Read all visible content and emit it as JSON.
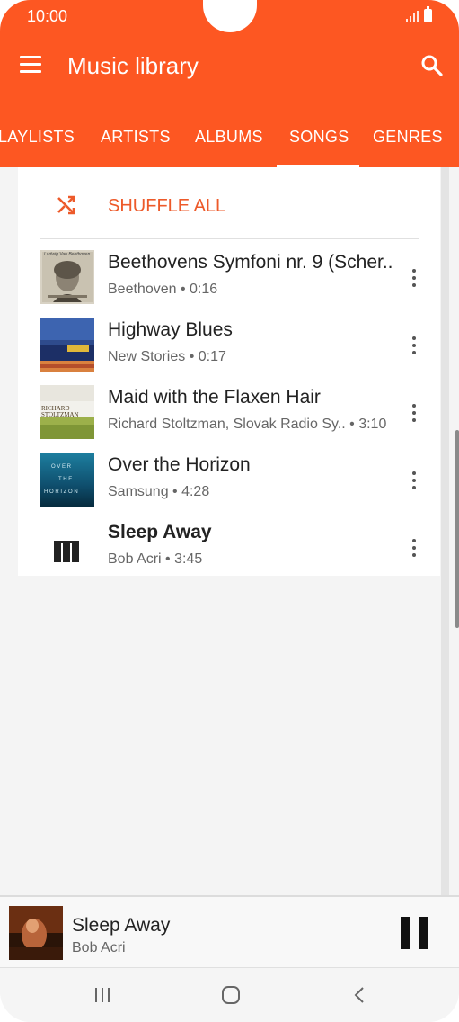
{
  "status_bar": {
    "time": "10:00",
    "icons": [
      "signal-icon",
      "battery-icon"
    ]
  },
  "header": {
    "title": "Music library",
    "menu_icon": "menu-icon",
    "search_icon": "search-icon"
  },
  "tabs": [
    {
      "label": "LAYLISTS",
      "selected": false
    },
    {
      "label": "ARTISTS",
      "selected": false
    },
    {
      "label": "ALBUMS",
      "selected": false
    },
    {
      "label": "SONGS",
      "selected": true
    },
    {
      "label": "GENRES",
      "selected": false
    }
  ],
  "shuffle": {
    "label": "SHUFFLE ALL",
    "icon": "shuffle-icon"
  },
  "songs": [
    {
      "title": "Beethovens Symfoni nr. 9 (Scher..",
      "subtitle": "Beethoven • 0:16",
      "playing": false
    },
    {
      "title": "Highway Blues",
      "subtitle": "New Stories • 0:17",
      "playing": false
    },
    {
      "title": "Maid with the Flaxen Hair",
      "subtitle": "Richard Stoltzman, Slovak Radio Sy..  • 3:10",
      "playing": false
    },
    {
      "title": "Over the Horizon",
      "subtitle": "Samsung • 4:28",
      "playing": false
    },
    {
      "title": "Sleep Away",
      "subtitle": "Bob Acri • 3:45",
      "playing": true
    }
  ],
  "album_art_text": {
    "beethoven": "Ludwig Van Beethoven",
    "stoltzman": [
      "RICHARD",
      "STOLTZMAN"
    ],
    "horizon": [
      "O V E R",
      "T H E",
      "H O R I Z O N"
    ]
  },
  "now_playing": {
    "title": "Sleep Away",
    "artist": "Bob Acri",
    "state_icon": "pause-icon"
  },
  "navigation": [
    "recent-apps-icon",
    "home-icon",
    "back-icon"
  ],
  "colors": {
    "accent": "#fd5722",
    "shuffle_text": "#ed5a2a",
    "background": "#f4f4f4"
  }
}
